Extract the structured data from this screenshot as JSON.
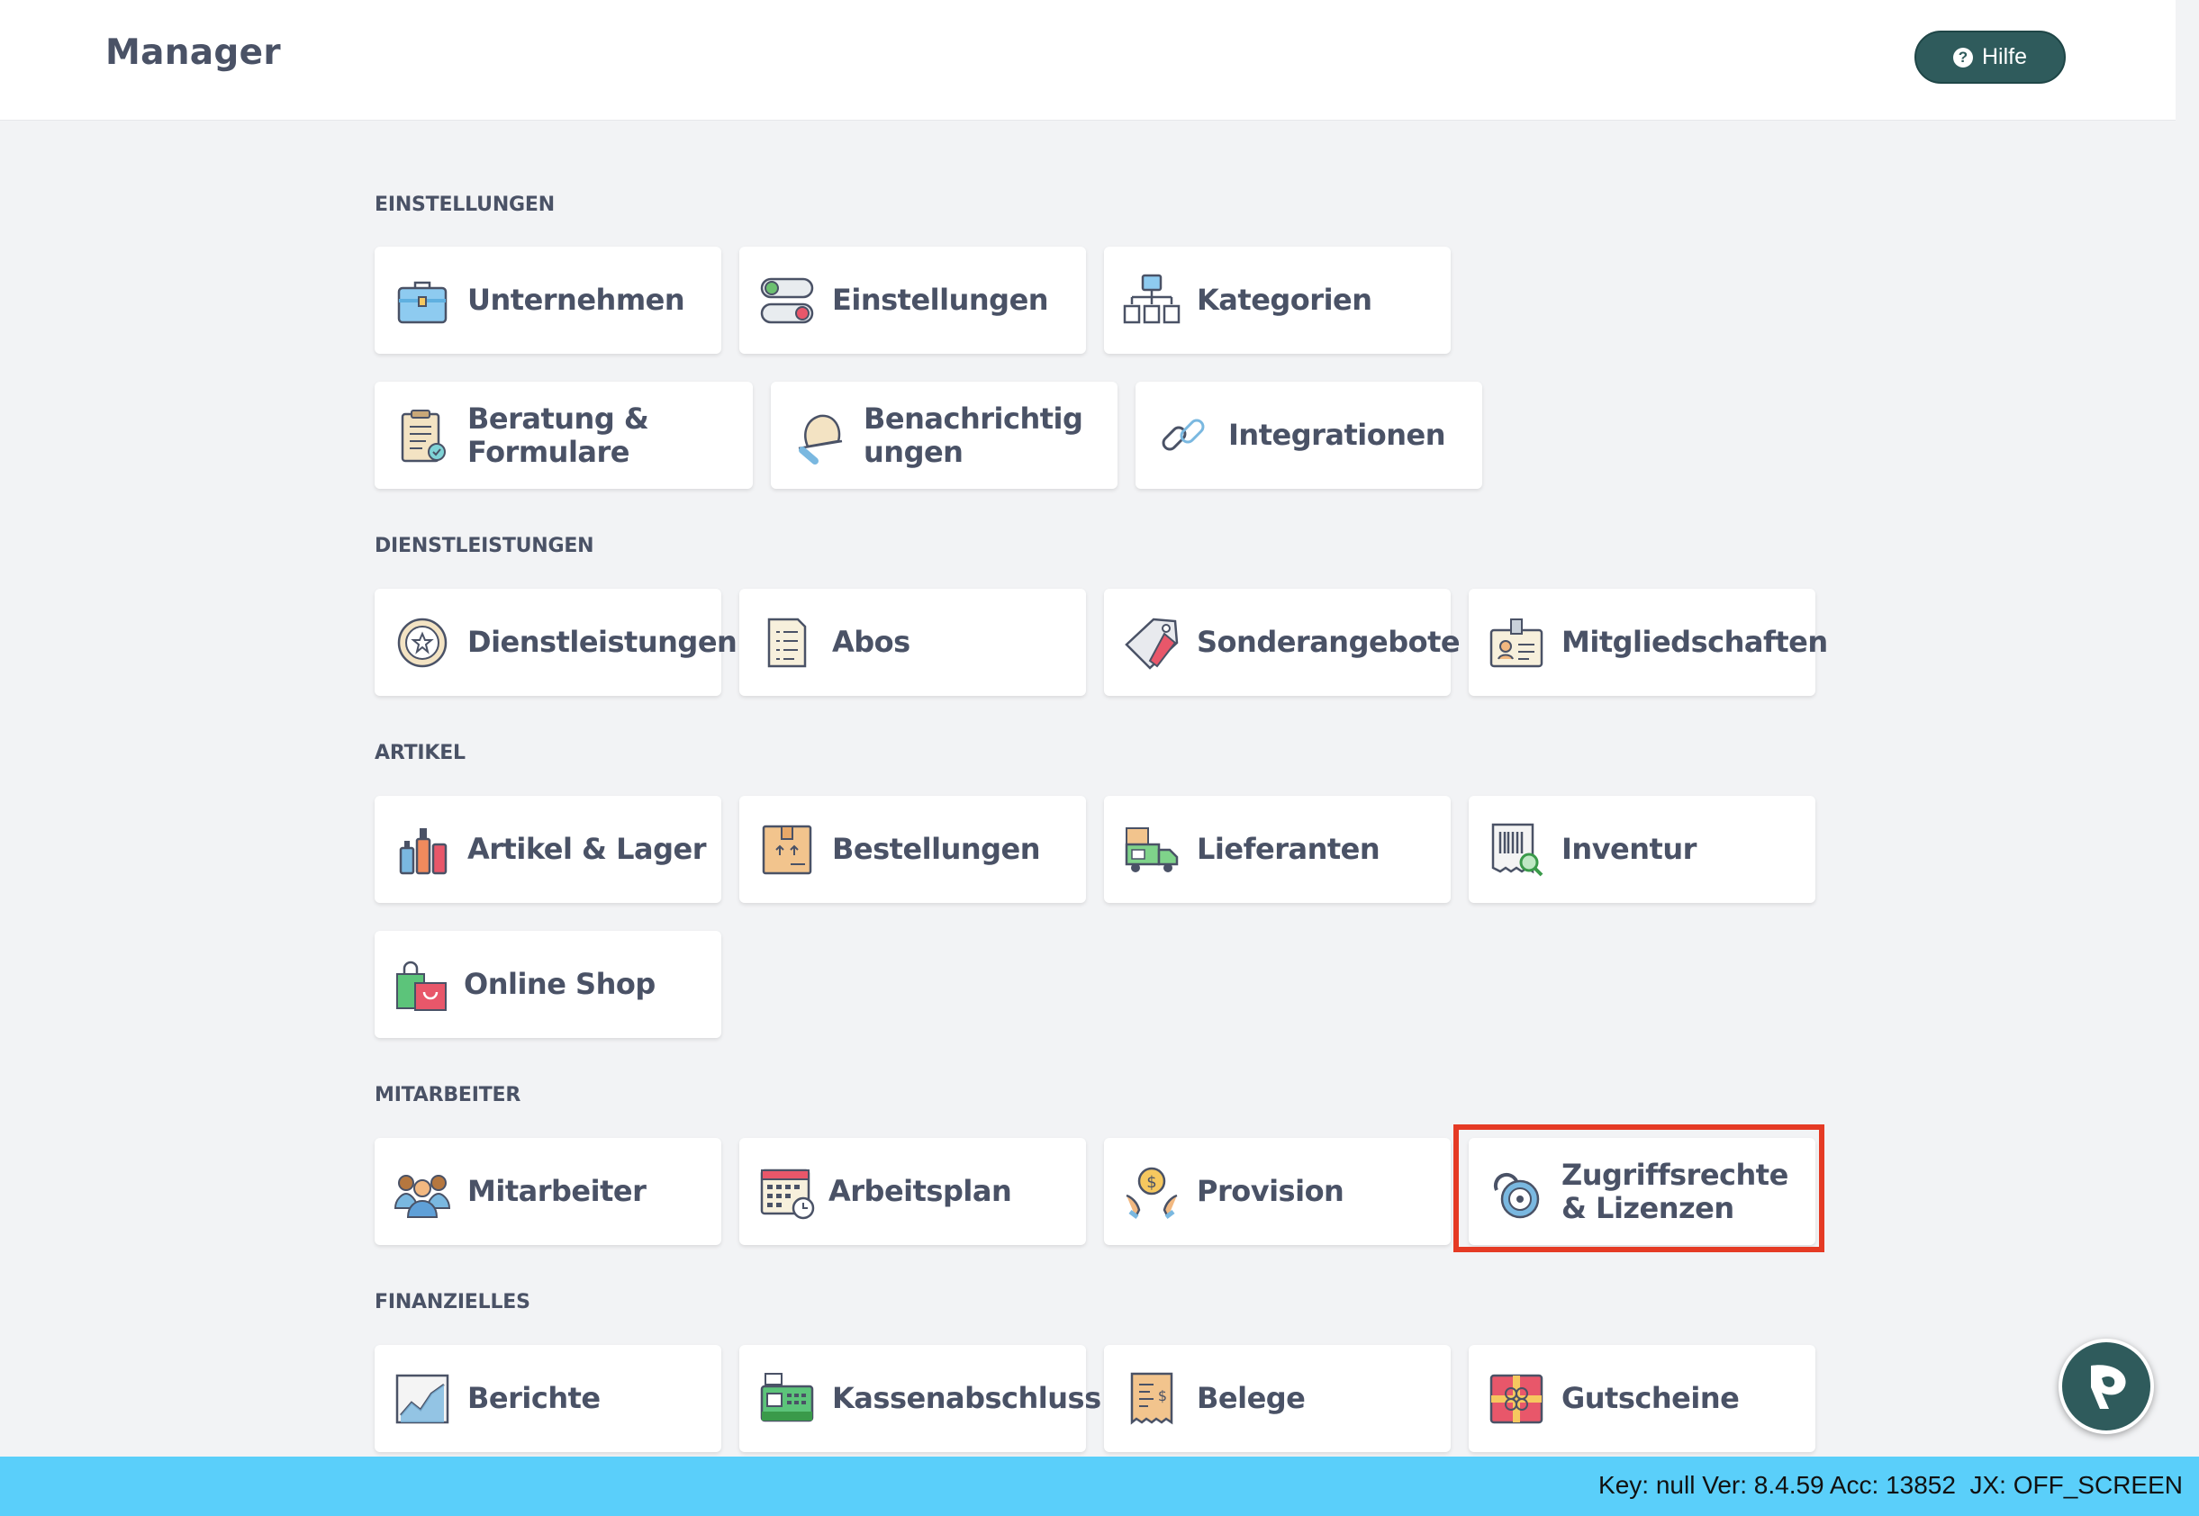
{
  "header": {
    "title": "Manager",
    "help_label": "Hilfe"
  },
  "sections": [
    {
      "title": "EINSTELLUNGEN",
      "items": [
        {
          "label": "Unternehmen",
          "icon": "briefcase-icon"
        },
        {
          "label": "Einstellungen",
          "icon": "toggle-switches-icon"
        },
        {
          "label": "Kategorien",
          "icon": "hierarchy-icon"
        },
        {
          "label": "Beratung & Formulare",
          "icon": "clipboard-form-icon"
        },
        {
          "label": "Benachrichtigungen",
          "icon": "bell-icon"
        },
        {
          "label": "Integrationen",
          "icon": "chain-link-icon"
        }
      ]
    },
    {
      "title": "DIENSTLEISTUNGEN",
      "items": [
        {
          "label": "Dienstleistungen",
          "icon": "service-badge-icon"
        },
        {
          "label": "Abos",
          "icon": "document-list-icon"
        },
        {
          "label": "Sonderangebote",
          "icon": "price-tag-icon"
        },
        {
          "label": "Mitgliedschaften",
          "icon": "id-badge-icon"
        }
      ]
    },
    {
      "title": "ARTIKEL",
      "items": [
        {
          "label": "Artikel & Lager",
          "icon": "cosmetic-bottles-icon"
        },
        {
          "label": "Bestellungen",
          "icon": "package-box-icon"
        },
        {
          "label": "Lieferanten",
          "icon": "delivery-truck-icon"
        },
        {
          "label": "Inventur",
          "icon": "barcode-scan-icon"
        },
        {
          "label": "Online Shop",
          "icon": "shopping-bag-icon"
        }
      ]
    },
    {
      "title": "MITARBEITER",
      "items": [
        {
          "label": "Mitarbeiter",
          "icon": "team-people-icon"
        },
        {
          "label": "Arbeitsplan",
          "icon": "calendar-clock-icon"
        },
        {
          "label": "Provision",
          "icon": "hands-coin-icon"
        },
        {
          "label": "Zugriffsrechte & Lizenzen",
          "icon": "combination-lock-icon"
        }
      ]
    },
    {
      "title": "FINANZIELLES",
      "items": [
        {
          "label": "Berichte",
          "icon": "growth-chart-icon"
        },
        {
          "label": "Kassenabschluss",
          "icon": "cash-register-icon"
        },
        {
          "label": "Belege",
          "icon": "receipt-icon"
        },
        {
          "label": "Gutscheine",
          "icon": "gift-voucher-icon"
        }
      ]
    }
  ],
  "status_bar": {
    "text": "Key: null Ver: 8.4.59 Acc: 13852  JX: OFF_SCREEN"
  },
  "colors": {
    "accent": "#2f5b5c",
    "status_bar": "#5acffa",
    "highlight": "#e53a24"
  }
}
